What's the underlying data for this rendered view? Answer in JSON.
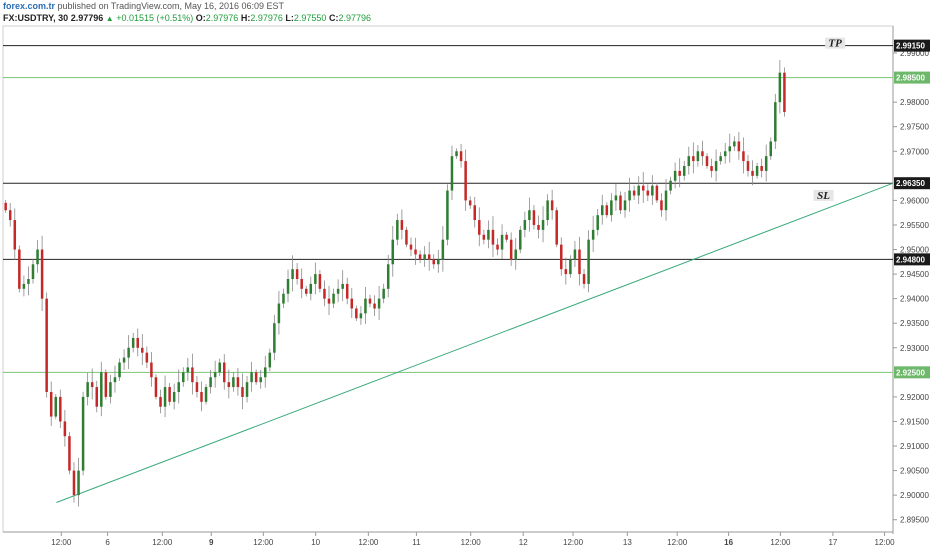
{
  "header": {
    "brand": "forex.com.tr",
    "published": "published on TradingView.com, May 16, 2016 06:09 EST",
    "symbol": "FX:USDTRY, 30",
    "last": "2.97796",
    "change": "+0.01515 (+0.51%)",
    "o_label": "O:",
    "o_value": "2.97976",
    "h_label": "H:",
    "h_value": "2.97976",
    "l_label": "L:",
    "l_value": "2.97550",
    "c_label": "C:",
    "c_value": "2.97796"
  },
  "colors": {
    "up": "#2e7d32",
    "down": "#c62828",
    "wick": "#888888",
    "green_level": "#7cc576",
    "black_level": "#222222",
    "trendline": "#3aaa7a"
  },
  "chart_data": {
    "type": "candlestick",
    "y_ticks": [
      "2.99000",
      "2.98000",
      "2.97500",
      "2.97000",
      "2.96000",
      "2.95500",
      "2.95000",
      "2.94500",
      "2.94000",
      "2.93500",
      "2.93000",
      "2.92000",
      "2.91500",
      "2.91000",
      "2.90500",
      "2.90000",
      "2.89500"
    ],
    "y_range": [
      2.8925,
      2.9955
    ],
    "x_ticks": [
      {
        "label": "12:00",
        "pos": 0.0655,
        "bold": false
      },
      {
        "label": "6",
        "pos": 0.1175,
        "bold": false
      },
      {
        "label": "12:00",
        "pos": 0.179,
        "bold": false
      },
      {
        "label": "9",
        "pos": 0.234,
        "bold": true
      },
      {
        "label": "12:00",
        "pos": 0.2925,
        "bold": false
      },
      {
        "label": "10",
        "pos": 0.3513,
        "bold": false
      },
      {
        "label": "12:00",
        "pos": 0.4105,
        "bold": false
      },
      {
        "label": "11",
        "pos": 0.4645,
        "bold": false
      },
      {
        "label": "12:00",
        "pos": 0.5255,
        "bold": false
      },
      {
        "label": "12",
        "pos": 0.5845,
        "bold": false
      },
      {
        "label": "12:00",
        "pos": 0.6405,
        "bold": false
      },
      {
        "label": "13",
        "pos": 0.7015,
        "bold": false
      },
      {
        "label": "12:00",
        "pos": 0.7575,
        "bold": false
      },
      {
        "label": "16",
        "pos": 0.8153,
        "bold": true
      },
      {
        "label": "12:00",
        "pos": 0.8735,
        "bold": false
      },
      {
        "label": "17",
        "pos": 0.9325,
        "bold": false
      },
      {
        "label": "12:00",
        "pos": 0.9905,
        "bold": false
      }
    ],
    "levels": [
      {
        "value": 2.9915,
        "label": "2.99150",
        "style": "black"
      },
      {
        "value": 2.985,
        "label": "2.98500",
        "style": "green"
      },
      {
        "value": 2.9635,
        "label": "2.96350",
        "style": "black"
      },
      {
        "value": 2.948,
        "label": "2.94800",
        "style": "black"
      },
      {
        "value": 2.925,
        "label": "2.92500",
        "style": "green"
      }
    ],
    "trendline": {
      "from": {
        "pos": 0.06,
        "value": 2.8985
      },
      "to": {
        "pos": 1.0,
        "value": 2.9635
      }
    },
    "annotations": [
      {
        "text": "TP",
        "pos": 0.935,
        "value": 2.9915
      },
      {
        "text": "SL",
        "pos": 0.922,
        "value": 2.9605
      }
    ],
    "closes": [
      2.958,
      2.956,
      2.95,
      2.942,
      2.943,
      2.944,
      2.947,
      2.95,
      2.94,
      2.921,
      2.916,
      2.92,
      2.915,
      2.912,
      2.905,
      2.9,
      2.905,
      2.92,
      2.923,
      2.922,
      2.918,
      2.925,
      2.92,
      2.923,
      2.924,
      2.927,
      2.928,
      2.93,
      2.932,
      2.93,
      2.929,
      2.927,
      2.924,
      2.92,
      2.918,
      2.922,
      2.919,
      2.921,
      2.923,
      2.925,
      2.926,
      2.923,
      2.921,
      2.919,
      2.922,
      2.924,
      2.925,
      2.927,
      2.923,
      2.922,
      2.924,
      2.922,
      2.92,
      2.923,
      2.925,
      2.923,
      2.924,
      2.926,
      2.929,
      2.935,
      2.939,
      2.941,
      2.944,
      2.946,
      2.944,
      2.942,
      2.941,
      2.943,
      2.945,
      2.942,
      2.94,
      2.939,
      2.941,
      2.942,
      2.943,
      2.94,
      2.938,
      2.936,
      2.937,
      2.94,
      2.939,
      2.938,
      2.94,
      2.942,
      2.947,
      2.952,
      2.956,
      2.954,
      2.951,
      2.95,
      2.949,
      2.948,
      2.949,
      2.948,
      2.947,
      2.948,
      2.952,
      2.962,
      2.969,
      2.97,
      2.968,
      2.96,
      2.959,
      2.956,
      2.953,
      2.952,
      2.954,
      2.951,
      2.95,
      2.953,
      2.952,
      2.948,
      2.95,
      2.954,
      2.956,
      2.958,
      2.955,
      2.954,
      2.956,
      2.96,
      2.958,
      2.951,
      2.946,
      2.945,
      2.948,
      2.95,
      2.945,
      2.943,
      2.952,
      2.954,
      2.957,
      2.959,
      2.957,
      2.96,
      2.961,
      2.958,
      2.96,
      2.962,
      2.961,
      2.963,
      2.962,
      2.961,
      2.963,
      2.96,
      2.958,
      2.962,
      2.964,
      2.966,
      2.965,
      2.967,
      2.969,
      2.968,
      2.97,
      2.969,
      2.967,
      2.966,
      2.968,
      2.969,
      2.97,
      2.971,
      2.972,
      2.97,
      2.968,
      2.966,
      2.965,
      2.967,
      2.966,
      2.969,
      2.972,
      2.98,
      2.986,
      2.978
    ]
  }
}
